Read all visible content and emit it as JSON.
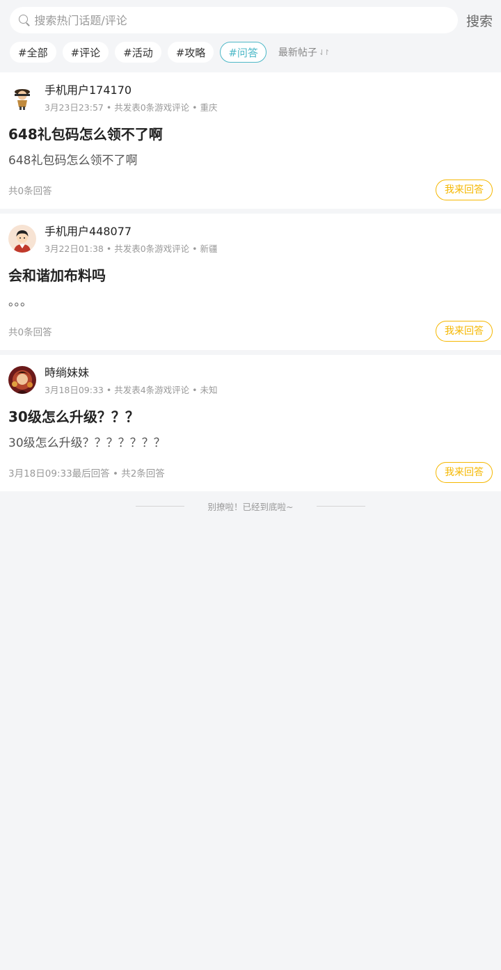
{
  "search": {
    "placeholder": "搜索热门话题/评论",
    "button_label": "搜索"
  },
  "tags": [
    {
      "label": "#全部",
      "active": false
    },
    {
      "label": "#评论",
      "active": false
    },
    {
      "label": "#活动",
      "active": false
    },
    {
      "label": "#攻略",
      "active": false
    },
    {
      "label": "#问答",
      "active": true
    }
  ],
  "sort": {
    "label": "最新帖子",
    "icon": "sort-arrows-icon"
  },
  "posts": [
    {
      "user": "手机用户174170",
      "meta": "3月23日23:57 • 共发表0条游戏评论 • 重庆",
      "title": "648礼包码怎么领不了啊",
      "content": "648礼包码怎么领不了啊",
      "count": "共0条回答",
      "answer_label": "我来回答",
      "avatar": "cartoon-character-avatar"
    },
    {
      "user": "手机用户448077",
      "meta": "3月22日01:38 • 共发表0条游戏评论 • 新疆",
      "title": "会和谐加布料吗",
      "content": "。。。",
      "count": "共0条回答",
      "answer_label": "我来回答",
      "avatar": "cartoon-boy-avatar"
    },
    {
      "user": "時绱妹妹",
      "meta": "3月18日09:33 • 共发表4条游戏评论 • 未知",
      "title": "30级怎么升级？？？",
      "content": "30级怎么升级？？？？？？？",
      "count": "3月18日09:33最后回答 • 共2条回答",
      "answer_label": "我来回答",
      "avatar": "photo-avatar"
    }
  ],
  "footer_tip": "别撩啦！已经到底啦~"
}
